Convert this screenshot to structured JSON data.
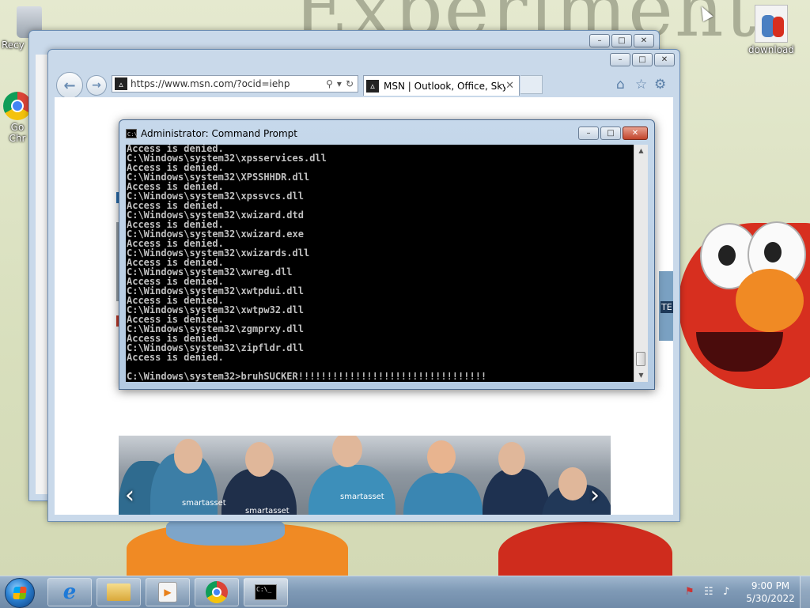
{
  "desktop": {
    "wallpaper_title": "Experiment",
    "icons": [
      {
        "label": "Recy",
        "icon": "recycle-bin-icon"
      },
      {
        "label": "Go\nChr",
        "icon": "chrome-icon"
      },
      {
        "label": "download",
        "icon": "download-icon"
      }
    ]
  },
  "back_window": {
    "buttons": {
      "minimize": "–",
      "maximize": "□",
      "close": "✕"
    }
  },
  "ie": {
    "back_icon": "back-arrow-icon",
    "forward_icon": "forward-arrow-icon",
    "address_url": "https://www.msn.com/?ocid=iehp",
    "address_url_domain": "msn.com",
    "tab_title": "MSN | Outlook, Office, Sky...",
    "tab_close": "✕",
    "favicon": "msn-icon",
    "tools": [
      "home-icon",
      "favorites-star-icon",
      "settings-gear-icon"
    ],
    "page": {
      "carousel_prev": "‹",
      "carousel_next": "›",
      "brand_text": "smartasset",
      "ad_fragment": "TE"
    }
  },
  "cmd": {
    "title": "Administrator: Command Prompt",
    "icon_text": "C:\\_",
    "lines": [
      "Access is denied.",
      "C:\\Windows\\system32\\xpsservices.dll",
      "Access is denied.",
      "C:\\Windows\\system32\\XPSSHHDR.dll",
      "Access is denied.",
      "C:\\Windows\\system32\\xpssvcs.dll",
      "Access is denied.",
      "C:\\Windows\\system32\\xwizard.dtd",
      "Access is denied.",
      "C:\\Windows\\system32\\xwizard.exe",
      "Access is denied.",
      "C:\\Windows\\system32\\xwizards.dll",
      "Access is denied.",
      "C:\\Windows\\system32\\xwreg.dll",
      "Access is denied.",
      "C:\\Windows\\system32\\xwtpdui.dll",
      "Access is denied.",
      "C:\\Windows\\system32\\xwtpw32.dll",
      "Access is denied.",
      "C:\\Windows\\system32\\zgmprxy.dll",
      "Access is denied.",
      "C:\\Windows\\system32\\zipfldr.dll",
      "Access is denied.",
      "",
      "C:\\Windows\\system32>bruhSUCKER!!!!!!!!!!!!!!!!!!!!!!!!!!!!!!!!!"
    ]
  },
  "taskbar": {
    "apps": [
      {
        "name": "internet-explorer",
        "icon": "ie-icon",
        "glyph": "e"
      },
      {
        "name": "windows-explorer",
        "icon": "folder-icon"
      },
      {
        "name": "media-player",
        "icon": "media-player-icon",
        "glyph": "▶"
      },
      {
        "name": "google-chrome",
        "icon": "chrome-icon"
      },
      {
        "name": "command-prompt",
        "icon": "cmd-icon",
        "glyph": "C:\\_"
      }
    ],
    "tray": [
      {
        "icon": "action-center-flag-icon",
        "glyph": "⚑"
      },
      {
        "icon": "network-icon",
        "glyph": "☷"
      },
      {
        "icon": "volume-icon",
        "glyph": "♪"
      }
    ],
    "time": "9:00 PM",
    "date": "5/30/2022"
  }
}
